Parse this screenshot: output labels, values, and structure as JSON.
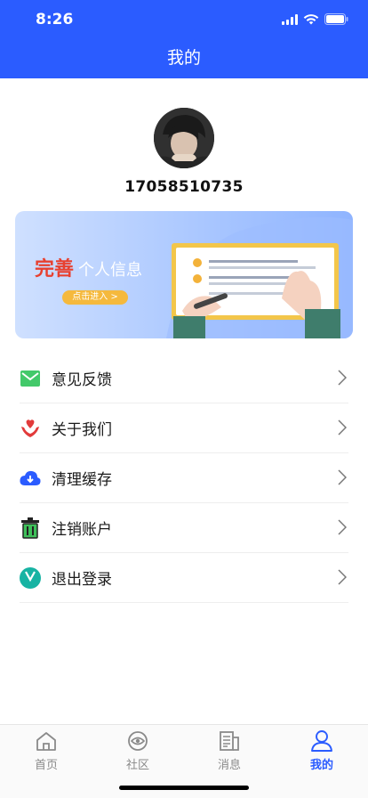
{
  "status": {
    "time": "8:26"
  },
  "nav": {
    "title": "我的"
  },
  "profile": {
    "phone": "17058510735"
  },
  "banner": {
    "title_highlight": "完善",
    "title_rest": "个人信息",
    "button_label": "点击进入 >"
  },
  "menu": [
    {
      "label": "意见反馈",
      "icon": "mail-icon"
    },
    {
      "label": "关于我们",
      "icon": "heart-hands-icon"
    },
    {
      "label": "清理缓存",
      "icon": "cloud-download-icon"
    },
    {
      "label": "注销账户",
      "icon": "trash-icon"
    },
    {
      "label": "退出登录",
      "icon": "logout-icon"
    }
  ],
  "tabs": [
    {
      "label": "首页",
      "icon": "home-icon",
      "active": false
    },
    {
      "label": "社区",
      "icon": "eye-icon",
      "active": false
    },
    {
      "label": "消息",
      "icon": "news-icon",
      "active": false
    },
    {
      "label": "我的",
      "icon": "user-icon",
      "active": true
    }
  ],
  "colors": {
    "primary": "#2b5cff",
    "accent_red": "#e8402f",
    "button_yellow": "#f5b93d"
  }
}
